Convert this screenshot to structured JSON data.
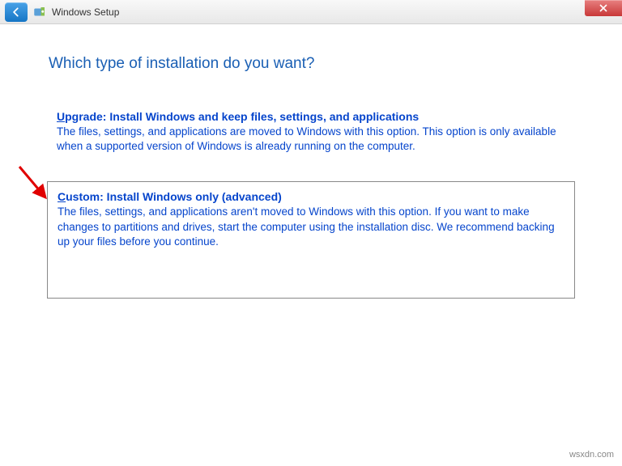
{
  "titlebar": {
    "title": "Windows Setup"
  },
  "heading": "Which type of installation do you want?",
  "options": {
    "upgrade": {
      "hotkey": "U",
      "title_rest": "pgrade: Install Windows and keep files, settings, and applications",
      "desc": "The files, settings, and applications are moved to Windows with this option. This option is only available when a supported version of Windows is already running on the computer."
    },
    "custom": {
      "hotkey": "C",
      "title_rest": "ustom: Install Windows only (advanced)",
      "desc": "The files, settings, and applications aren't moved to Windows with this option. If you want to make changes to partitions and drives, start the computer using the installation disc. We recommend backing up your files before you continue."
    }
  },
  "watermark": "wsxdn.com"
}
